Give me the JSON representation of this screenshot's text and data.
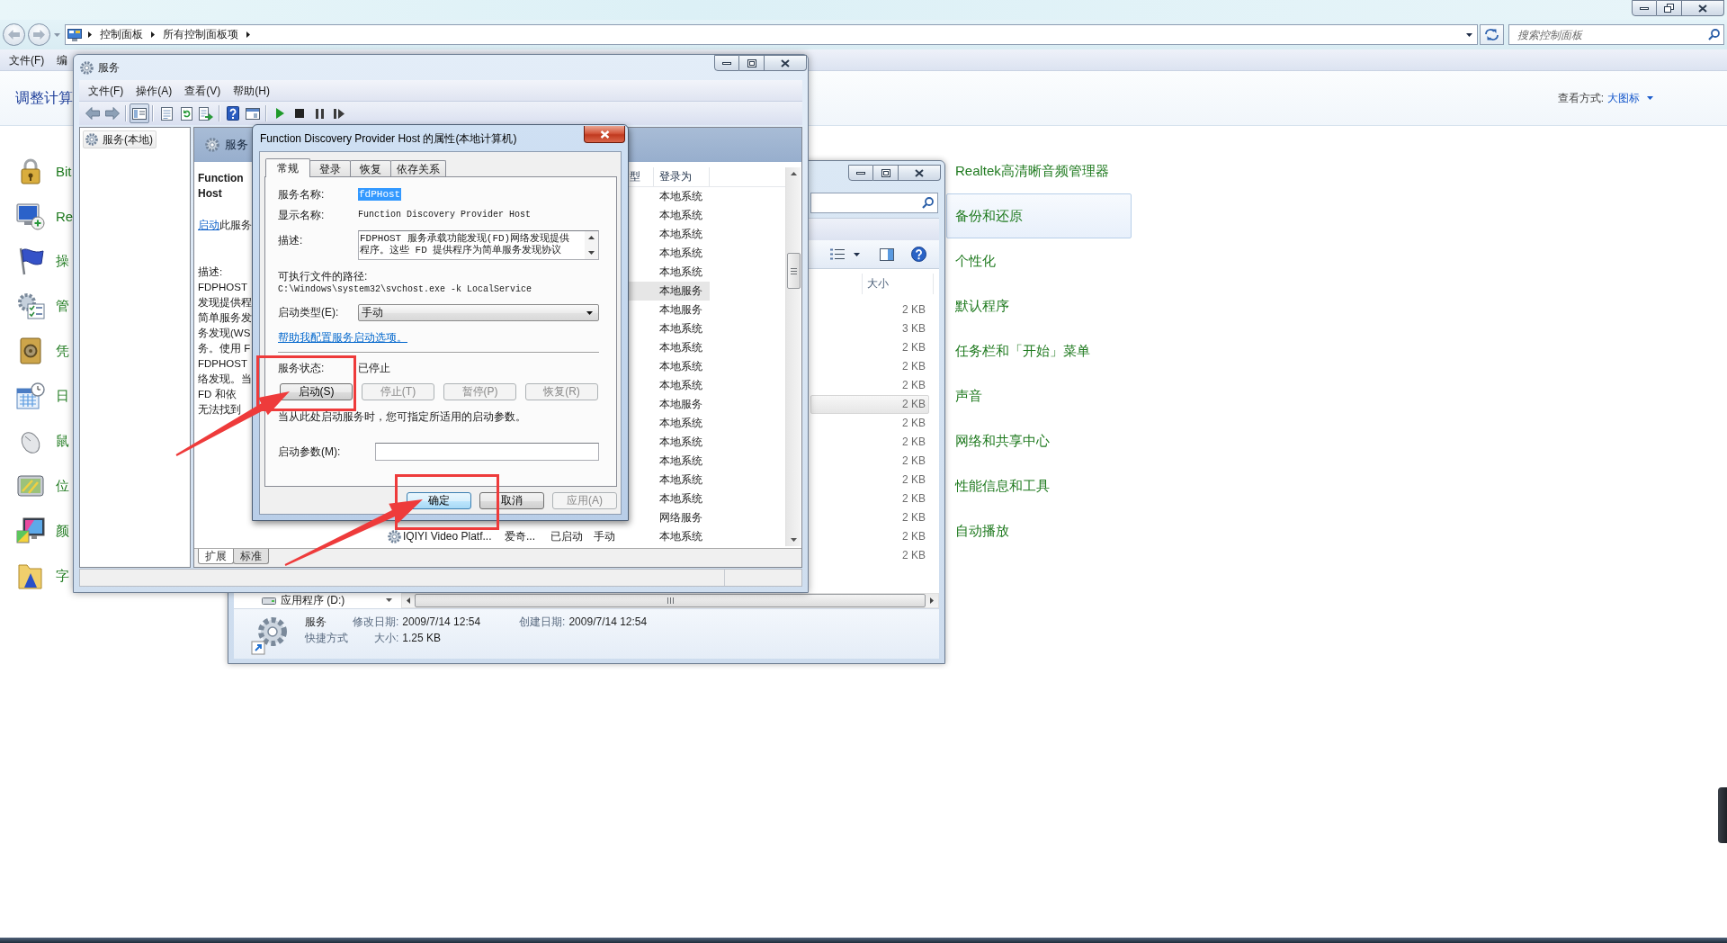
{
  "control_panel": {
    "address": {
      "crumbs": [
        "控制面板",
        "所有控制面板项"
      ]
    },
    "search": {
      "placeholder": "搜索控制面板"
    },
    "menu": [
      "文件(F)",
      "编"
    ],
    "heading": "调整计算",
    "view_by": {
      "label": "查看方式:",
      "value": "大图标"
    },
    "left_items": [
      {
        "label": "Bit"
      },
      {
        "label": "Re"
      },
      {
        "label": "操"
      },
      {
        "label": "管"
      },
      {
        "label": "凭"
      },
      {
        "label": "日"
      },
      {
        "label": "鼠"
      },
      {
        "label": "位"
      },
      {
        "label": "颜"
      },
      {
        "label": "字"
      }
    ],
    "right_items": [
      {
        "label": "Realtek高清晰音频管理器",
        "selected": false
      },
      {
        "label": "备份和还原",
        "selected": true
      },
      {
        "label": "个性化",
        "selected": false
      },
      {
        "label": "默认程序",
        "selected": false
      },
      {
        "label": "任务栏和「开始」菜单",
        "selected": false
      },
      {
        "label": "声音",
        "selected": false
      },
      {
        "label": "网络和共享中心",
        "selected": false
      },
      {
        "label": "性能信息和工具",
        "selected": false
      },
      {
        "label": "自动播放",
        "selected": false
      }
    ]
  },
  "explorer": {
    "columns": [
      "大小"
    ],
    "rows": [
      {
        "size": "2 KB",
        "selected": false
      },
      {
        "size": "3 KB",
        "selected": false
      },
      {
        "size": "2 KB",
        "selected": false
      },
      {
        "size": "2 KB",
        "selected": false
      },
      {
        "size": "2 KB",
        "selected": false
      },
      {
        "size": "2 KB",
        "selected": true
      },
      {
        "size": "2 KB",
        "selected": false
      },
      {
        "size": "2 KB",
        "selected": false
      },
      {
        "size": "2 KB",
        "selected": false
      },
      {
        "size": "2 KB",
        "selected": false
      },
      {
        "size": "2 KB",
        "selected": false
      },
      {
        "size": "2 KB",
        "selected": false
      },
      {
        "size": "2 KB",
        "selected": false
      },
      {
        "size": "2 KB",
        "selected": false
      }
    ],
    "nav_item": "应用程序 (D:)",
    "details": {
      "name": "服务",
      "type": "快捷方式",
      "field_columns": [
        [
          {
            "label": "修改日期:",
            "value": "2009/7/14 12:54"
          },
          {
            "label": "大小:",
            "value": "1.25 KB"
          }
        ],
        [
          {
            "label": "创建日期:",
            "value": "2009/7/14 12:54"
          }
        ]
      ]
    }
  },
  "services": {
    "title": "服务",
    "menu": [
      "文件(F)",
      "操作(A)",
      "查看(V)",
      "帮助(H)"
    ],
    "toolbar": [
      [
        {
          "pressed": false
        },
        {
          "pressed": false
        }
      ],
      [
        {
          "pressed": true
        }
      ],
      [
        {
          "pressed": false
        },
        {
          "pressed": false
        },
        {
          "pressed": false
        }
      ],
      [
        {
          "pressed": false
        },
        {
          "pressed": false
        }
      ],
      [
        {
          "pressed": false
        },
        {
          "pressed": false
        },
        {
          "pressed": false
        },
        {
          "pressed": false
        }
      ]
    ],
    "tree": [
      {
        "label": "服务(本地)",
        "selected": true
      }
    ],
    "pane_title": "服务",
    "detail": {
      "name_lines": [
        "Function",
        "Host"
      ],
      "start_link": "启动",
      "start_text": "此服务",
      "description_label": "描述:",
      "description_lines": [
        "FDPHOST",
        "发现提供程",
        "简单服务发",
        "务发现(WS",
        "务。使用 F",
        "FDPHOST",
        "络发现。当",
        "FD 和依",
        "无法找到"
      ]
    },
    "columns": [
      "型",
      "登录为"
    ],
    "rows": [
      {
        "logon": "本地系统",
        "selected": false
      },
      {
        "logon": "本地系统",
        "selected": false
      },
      {
        "logon": "本地系统",
        "selected": false
      },
      {
        "logon": "本地系统",
        "selected": false
      },
      {
        "logon": "本地系统",
        "selected": false
      },
      {
        "logon": "本地服务",
        "selected": true
      },
      {
        "logon": "本地服务",
        "selected": false
      },
      {
        "logon": "本地系统",
        "selected": false
      },
      {
        "logon": "本地系统",
        "selected": false
      },
      {
        "logon": "本地系统",
        "selected": false
      },
      {
        "logon": "本地系统",
        "selected": false
      },
      {
        "logon": "本地服务",
        "selected": false
      },
      {
        "logon": "本地系统",
        "selected": false
      },
      {
        "logon": "本地系统",
        "selected": false
      },
      {
        "logon": "本地系统",
        "selected": false
      },
      {
        "logon": "本地系统",
        "selected": false
      },
      {
        "logon": "本地系统",
        "selected": false
      },
      {
        "logon": "网络服务",
        "selected": false
      },
      {
        "name": "IQIYI Video Platf...",
        "description": "爱奇...",
        "status": "已启动",
        "startup": "手动",
        "logon": "本地系统",
        "selected": false
      }
    ],
    "view_tabs": [
      {
        "label": "扩展",
        "selected": true
      },
      {
        "label": "标准",
        "selected": false
      }
    ]
  },
  "dialog": {
    "title": "Function Discovery Provider Host 的属性(本地计算机)",
    "tabs": [
      {
        "label": "常规",
        "selected": true
      },
      {
        "label": "登录",
        "selected": false
      },
      {
        "label": "恢复",
        "selected": false
      },
      {
        "label": "依存关系",
        "selected": false
      }
    ],
    "service_name": {
      "label": "服务名称:",
      "value": "fdPHost",
      "selected": true
    },
    "display_name": {
      "label": "显示名称:",
      "value": "Function Discovery Provider Host"
    },
    "description": {
      "label": "描述:",
      "lines": [
        "FDPHOST 服务承载功能发现(FD)网络发现提供",
        "程序。这些 FD 提供程序为简单服务发现协议"
      ]
    },
    "path": {
      "label": "可执行文件的路径:",
      "value": "C:\\Windows\\system32\\svchost.exe -k LocalService"
    },
    "startup_type": {
      "label": "启动类型(E):",
      "value": "手动"
    },
    "help_link": "帮助我配置服务启动选项。",
    "status": {
      "label": "服务状态:",
      "value": "已停止"
    },
    "control_buttons": [
      {
        "label": "启动(S)",
        "disabled": false
      },
      {
        "label": "停止(T)",
        "disabled": true
      },
      {
        "label": "暂停(P)",
        "disabled": true
      },
      {
        "label": "恢复(R)",
        "disabled": true
      }
    ],
    "hint": "当从此处启动服务时，您可指定所适用的启动参数。",
    "start_params": {
      "label": "启动参数(M):"
    },
    "buttons": [
      {
        "label": "确定",
        "default": true,
        "disabled": false
      },
      {
        "label": "取消",
        "default": false,
        "disabled": false
      },
      {
        "label": "应用(A)",
        "default": false,
        "disabled": true
      }
    ]
  }
}
